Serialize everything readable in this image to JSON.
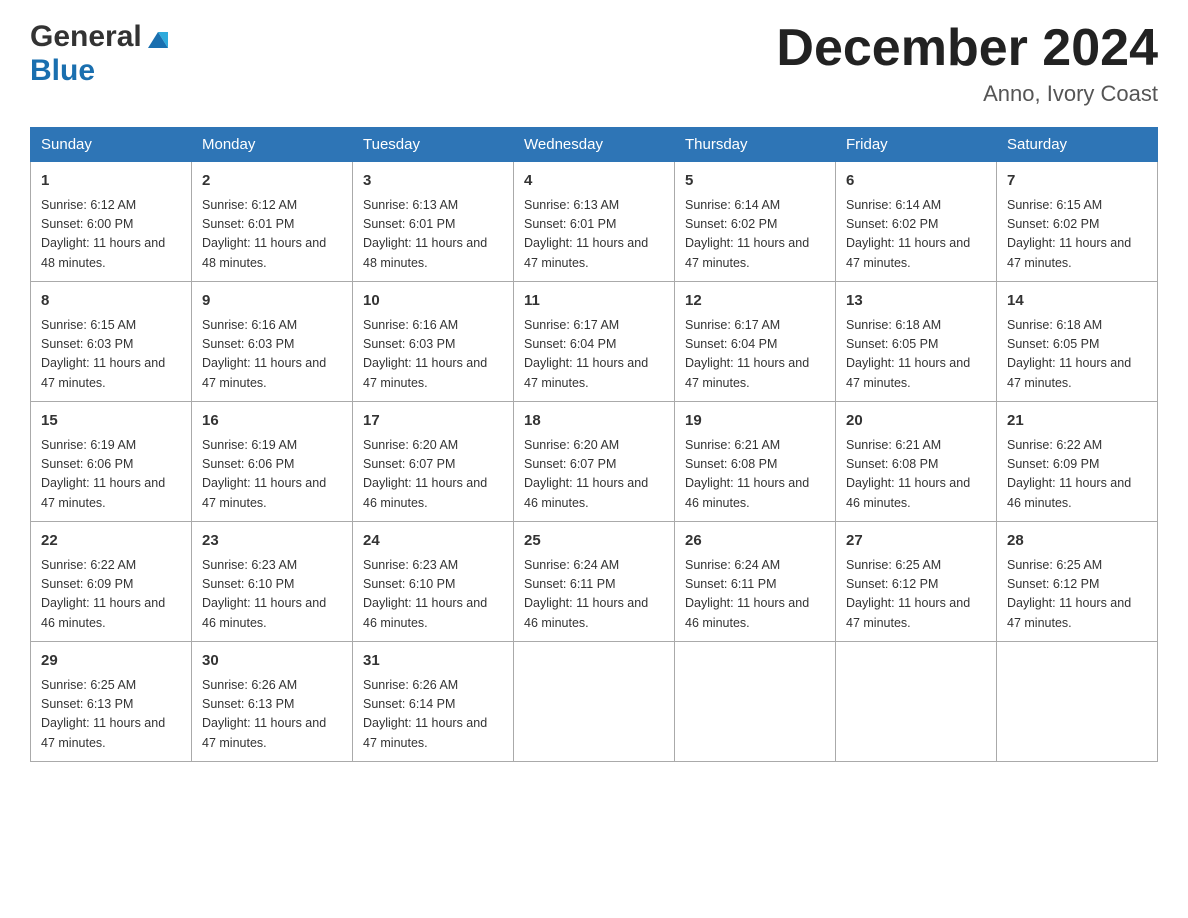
{
  "header": {
    "logo_general": "General",
    "logo_blue": "Blue",
    "title": "December 2024",
    "location": "Anno, Ivory Coast"
  },
  "days_of_week": [
    "Sunday",
    "Monday",
    "Tuesday",
    "Wednesday",
    "Thursday",
    "Friday",
    "Saturday"
  ],
  "weeks": [
    [
      {
        "day": "1",
        "sunrise": "Sunrise: 6:12 AM",
        "sunset": "Sunset: 6:00 PM",
        "daylight": "Daylight: 11 hours and 48 minutes."
      },
      {
        "day": "2",
        "sunrise": "Sunrise: 6:12 AM",
        "sunset": "Sunset: 6:01 PM",
        "daylight": "Daylight: 11 hours and 48 minutes."
      },
      {
        "day": "3",
        "sunrise": "Sunrise: 6:13 AM",
        "sunset": "Sunset: 6:01 PM",
        "daylight": "Daylight: 11 hours and 48 minutes."
      },
      {
        "day": "4",
        "sunrise": "Sunrise: 6:13 AM",
        "sunset": "Sunset: 6:01 PM",
        "daylight": "Daylight: 11 hours and 47 minutes."
      },
      {
        "day": "5",
        "sunrise": "Sunrise: 6:14 AM",
        "sunset": "Sunset: 6:02 PM",
        "daylight": "Daylight: 11 hours and 47 minutes."
      },
      {
        "day": "6",
        "sunrise": "Sunrise: 6:14 AM",
        "sunset": "Sunset: 6:02 PM",
        "daylight": "Daylight: 11 hours and 47 minutes."
      },
      {
        "day": "7",
        "sunrise": "Sunrise: 6:15 AM",
        "sunset": "Sunset: 6:02 PM",
        "daylight": "Daylight: 11 hours and 47 minutes."
      }
    ],
    [
      {
        "day": "8",
        "sunrise": "Sunrise: 6:15 AM",
        "sunset": "Sunset: 6:03 PM",
        "daylight": "Daylight: 11 hours and 47 minutes."
      },
      {
        "day": "9",
        "sunrise": "Sunrise: 6:16 AM",
        "sunset": "Sunset: 6:03 PM",
        "daylight": "Daylight: 11 hours and 47 minutes."
      },
      {
        "day": "10",
        "sunrise": "Sunrise: 6:16 AM",
        "sunset": "Sunset: 6:03 PM",
        "daylight": "Daylight: 11 hours and 47 minutes."
      },
      {
        "day": "11",
        "sunrise": "Sunrise: 6:17 AM",
        "sunset": "Sunset: 6:04 PM",
        "daylight": "Daylight: 11 hours and 47 minutes."
      },
      {
        "day": "12",
        "sunrise": "Sunrise: 6:17 AM",
        "sunset": "Sunset: 6:04 PM",
        "daylight": "Daylight: 11 hours and 47 minutes."
      },
      {
        "day": "13",
        "sunrise": "Sunrise: 6:18 AM",
        "sunset": "Sunset: 6:05 PM",
        "daylight": "Daylight: 11 hours and 47 minutes."
      },
      {
        "day": "14",
        "sunrise": "Sunrise: 6:18 AM",
        "sunset": "Sunset: 6:05 PM",
        "daylight": "Daylight: 11 hours and 47 minutes."
      }
    ],
    [
      {
        "day": "15",
        "sunrise": "Sunrise: 6:19 AM",
        "sunset": "Sunset: 6:06 PM",
        "daylight": "Daylight: 11 hours and 47 minutes."
      },
      {
        "day": "16",
        "sunrise": "Sunrise: 6:19 AM",
        "sunset": "Sunset: 6:06 PM",
        "daylight": "Daylight: 11 hours and 47 minutes."
      },
      {
        "day": "17",
        "sunrise": "Sunrise: 6:20 AM",
        "sunset": "Sunset: 6:07 PM",
        "daylight": "Daylight: 11 hours and 46 minutes."
      },
      {
        "day": "18",
        "sunrise": "Sunrise: 6:20 AM",
        "sunset": "Sunset: 6:07 PM",
        "daylight": "Daylight: 11 hours and 46 minutes."
      },
      {
        "day": "19",
        "sunrise": "Sunrise: 6:21 AM",
        "sunset": "Sunset: 6:08 PM",
        "daylight": "Daylight: 11 hours and 46 minutes."
      },
      {
        "day": "20",
        "sunrise": "Sunrise: 6:21 AM",
        "sunset": "Sunset: 6:08 PM",
        "daylight": "Daylight: 11 hours and 46 minutes."
      },
      {
        "day": "21",
        "sunrise": "Sunrise: 6:22 AM",
        "sunset": "Sunset: 6:09 PM",
        "daylight": "Daylight: 11 hours and 46 minutes."
      }
    ],
    [
      {
        "day": "22",
        "sunrise": "Sunrise: 6:22 AM",
        "sunset": "Sunset: 6:09 PM",
        "daylight": "Daylight: 11 hours and 46 minutes."
      },
      {
        "day": "23",
        "sunrise": "Sunrise: 6:23 AM",
        "sunset": "Sunset: 6:10 PM",
        "daylight": "Daylight: 11 hours and 46 minutes."
      },
      {
        "day": "24",
        "sunrise": "Sunrise: 6:23 AM",
        "sunset": "Sunset: 6:10 PM",
        "daylight": "Daylight: 11 hours and 46 minutes."
      },
      {
        "day": "25",
        "sunrise": "Sunrise: 6:24 AM",
        "sunset": "Sunset: 6:11 PM",
        "daylight": "Daylight: 11 hours and 46 minutes."
      },
      {
        "day": "26",
        "sunrise": "Sunrise: 6:24 AM",
        "sunset": "Sunset: 6:11 PM",
        "daylight": "Daylight: 11 hours and 46 minutes."
      },
      {
        "day": "27",
        "sunrise": "Sunrise: 6:25 AM",
        "sunset": "Sunset: 6:12 PM",
        "daylight": "Daylight: 11 hours and 47 minutes."
      },
      {
        "day": "28",
        "sunrise": "Sunrise: 6:25 AM",
        "sunset": "Sunset: 6:12 PM",
        "daylight": "Daylight: 11 hours and 47 minutes."
      }
    ],
    [
      {
        "day": "29",
        "sunrise": "Sunrise: 6:25 AM",
        "sunset": "Sunset: 6:13 PM",
        "daylight": "Daylight: 11 hours and 47 minutes."
      },
      {
        "day": "30",
        "sunrise": "Sunrise: 6:26 AM",
        "sunset": "Sunset: 6:13 PM",
        "daylight": "Daylight: 11 hours and 47 minutes."
      },
      {
        "day": "31",
        "sunrise": "Sunrise: 6:26 AM",
        "sunset": "Sunset: 6:14 PM",
        "daylight": "Daylight: 11 hours and 47 minutes."
      },
      null,
      null,
      null,
      null
    ]
  ]
}
